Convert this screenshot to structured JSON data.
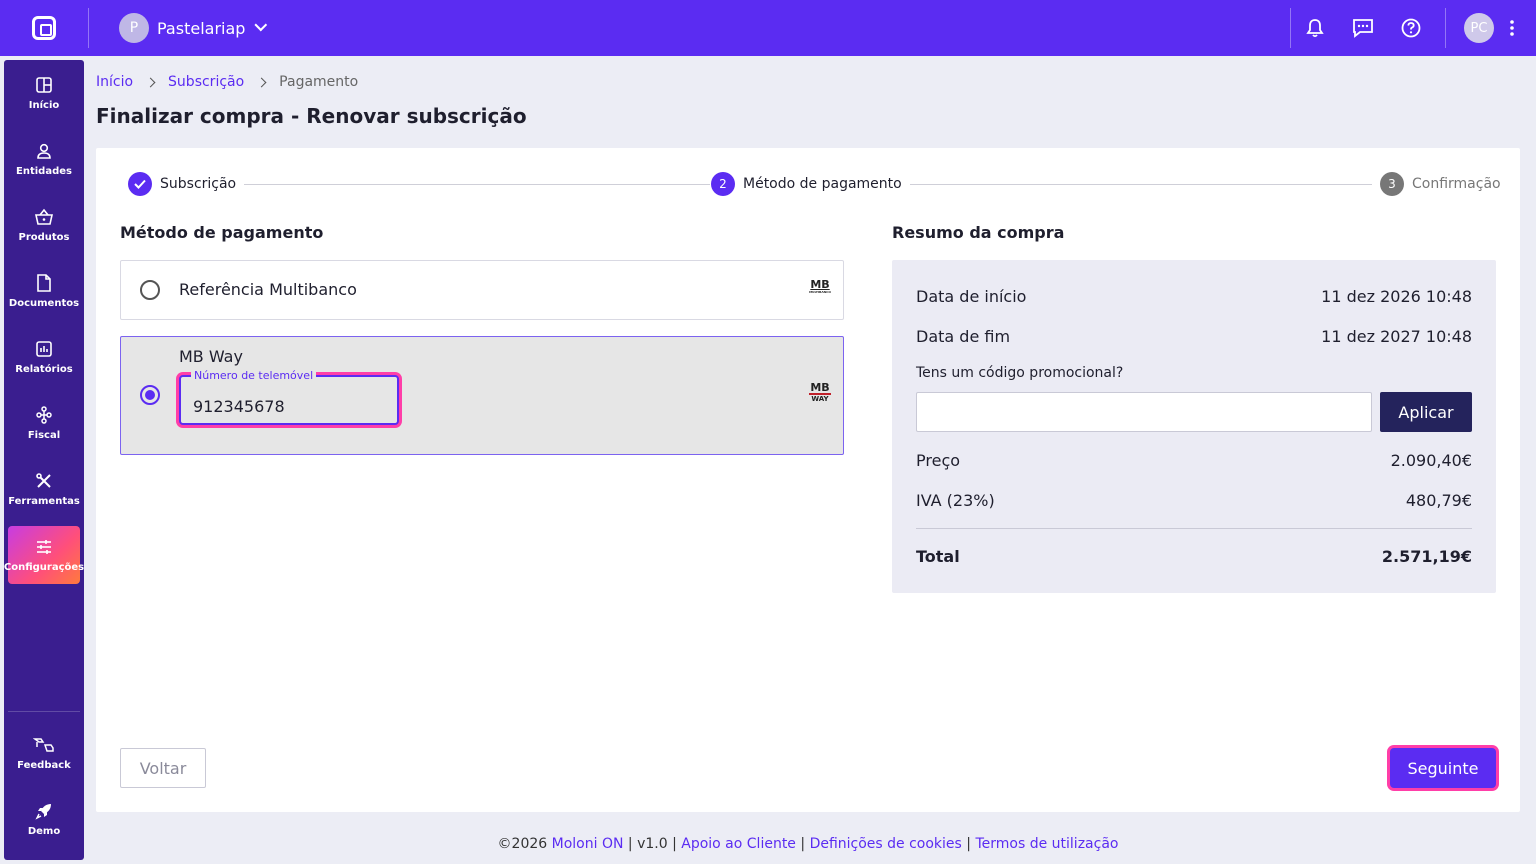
{
  "header": {
    "company_initial": "P",
    "company_name": "Pastelariap",
    "user_initials": "PC"
  },
  "sidebar": {
    "items": [
      {
        "label": "Início",
        "icon": "grid-icon"
      },
      {
        "label": "Entidades",
        "icon": "person-icon"
      },
      {
        "label": "Produtos",
        "icon": "basket-icon"
      },
      {
        "label": "Documentos",
        "icon": "document-icon"
      },
      {
        "label": "Relatórios",
        "icon": "chart-icon"
      },
      {
        "label": "Fiscal",
        "icon": "hierarchy-icon"
      },
      {
        "label": "Ferramentas",
        "icon": "tools-icon"
      },
      {
        "label": "Configurações",
        "icon": "sliders-icon",
        "active": true
      }
    ],
    "bottom": [
      {
        "label": "Feedback",
        "icon": "feedback-icon"
      },
      {
        "label": "Demo",
        "icon": "rocket-icon"
      }
    ]
  },
  "breadcrumb": {
    "home": "Início",
    "subscription": "Subscrição",
    "current": "Pagamento"
  },
  "page_title": "Finalizar compra - Renovar subscrição",
  "stepper": {
    "step1": {
      "label": "Subscrição",
      "state": "done"
    },
    "step2": {
      "number": "2",
      "label": "Método de pagamento",
      "state": "active"
    },
    "step3": {
      "number": "3",
      "label": "Confirmação",
      "state": "pending"
    }
  },
  "payment": {
    "title": "Método de pagamento",
    "option1": {
      "label": "Referência Multibanco",
      "logo": "MB",
      "logo_sub": "MULTIBANCO"
    },
    "option2": {
      "label": "MB Way",
      "logo": "MB",
      "logo_sub": "WAY",
      "phone_label": "Número de telemóvel",
      "phone_value": "912345678"
    }
  },
  "summary": {
    "title": "Resumo da compra",
    "start_label": "Data de início",
    "start_value": "11 dez 2026 10:48",
    "end_label": "Data de fim",
    "end_value": "11 dez 2027 10:48",
    "promo_label": "Tens um código promocional?",
    "apply_label": "Aplicar",
    "price_label": "Preço",
    "price_value": "2.090,40€",
    "vat_label": "IVA (23%)",
    "vat_value": "480,79€",
    "total_label": "Total",
    "total_value": "2.571,19€"
  },
  "actions": {
    "back_label": "Voltar",
    "next_label": "Seguinte"
  },
  "footer": {
    "copyright": "©2026",
    "brand": "Moloni ON",
    "version": "v1.0",
    "support": "Apoio ao Cliente",
    "cookies": "Definições de cookies",
    "terms": "Termos de utilização"
  },
  "colors": {
    "brand": "#5b2cf2",
    "sidebar": "#3a1e8f",
    "highlight": "#ff3ea8",
    "apply_button": "#24235c"
  }
}
